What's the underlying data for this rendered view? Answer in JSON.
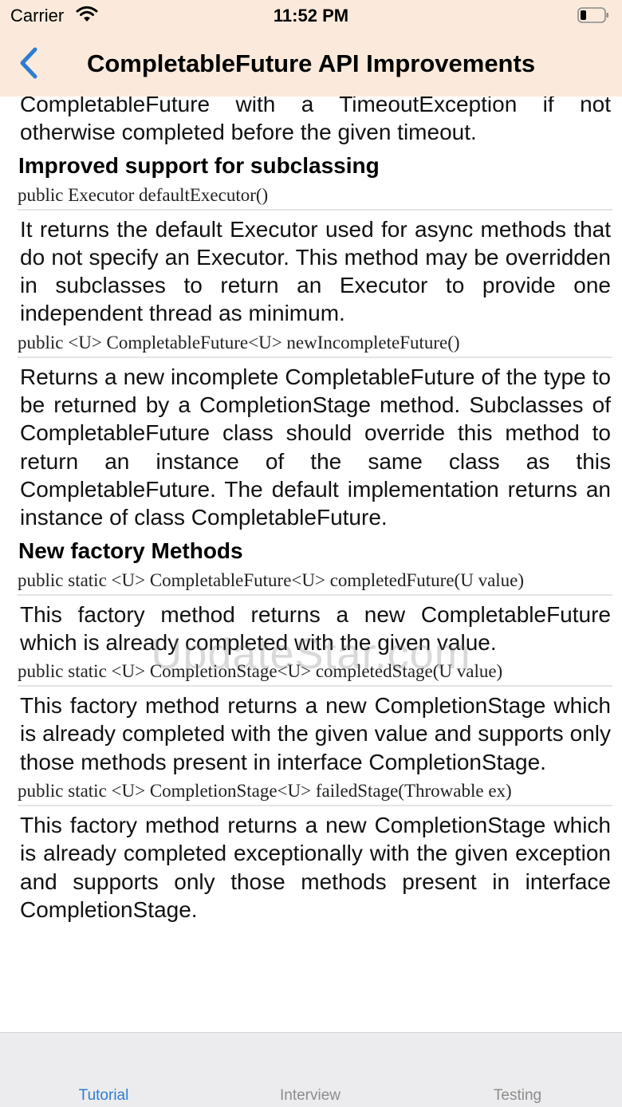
{
  "status_bar": {
    "carrier": "Carrier",
    "time": "11:52 PM"
  },
  "nav": {
    "title": "CompletableFuture API Improvements"
  },
  "content": {
    "p0": "CompletableFuture with a TimeoutException if not otherwise completed before the given timeout.",
    "h1": "Improved support for subclassing",
    "sig1": "public Executor defaultExecutor()",
    "p1": "It returns the default Executor used for async methods that do not specify an Executor. This method may be overridden in subclasses to return an Executor to provide one independent thread as minimum.",
    "sig2": "public <U> CompletableFuture<U> newIncompleteFuture()",
    "p2": "Returns a new incomplete CompletableFuture of the type to be returned by a CompletionStage method. Subclasses of CompletableFuture class should override this method to return an instance of the same class as this CompletableFuture. The default implementation returns an instance of class CompletableFuture.",
    "h2": "New factory Methods",
    "sig3": "public static <U> CompletableFuture<U> completedFuture(U value)",
    "p3": "This factory method returns a new CompletableFuture which is already completed with the given value.",
    "sig4": "public static <U> CompletionStage<U> completedStage(U value)",
    "p4": "This factory method returns a new CompletionStage which is already completed with the given value and supports only those methods present in interface CompletionStage.",
    "sig5": "public static <U> CompletionStage<U> failedStage(Throwable ex)",
    "p5": "This factory method returns a new CompletionStage which is already completed exceptionally with the given exception and supports only those methods present in interface CompletionStage."
  },
  "watermark": "UpdateStar.com",
  "tabs": [
    {
      "label": "Tutorial",
      "active": true
    },
    {
      "label": "Interview",
      "active": false
    },
    {
      "label": "Testing",
      "active": false
    }
  ],
  "colors": {
    "nav_background": "#fbeadb",
    "accent": "#2d7dd2",
    "tab_inactive": "#8c8c8c"
  },
  "icons": {
    "wifi": "wifi-icon",
    "battery": "battery-icon",
    "back": "chevron-left-icon"
  }
}
